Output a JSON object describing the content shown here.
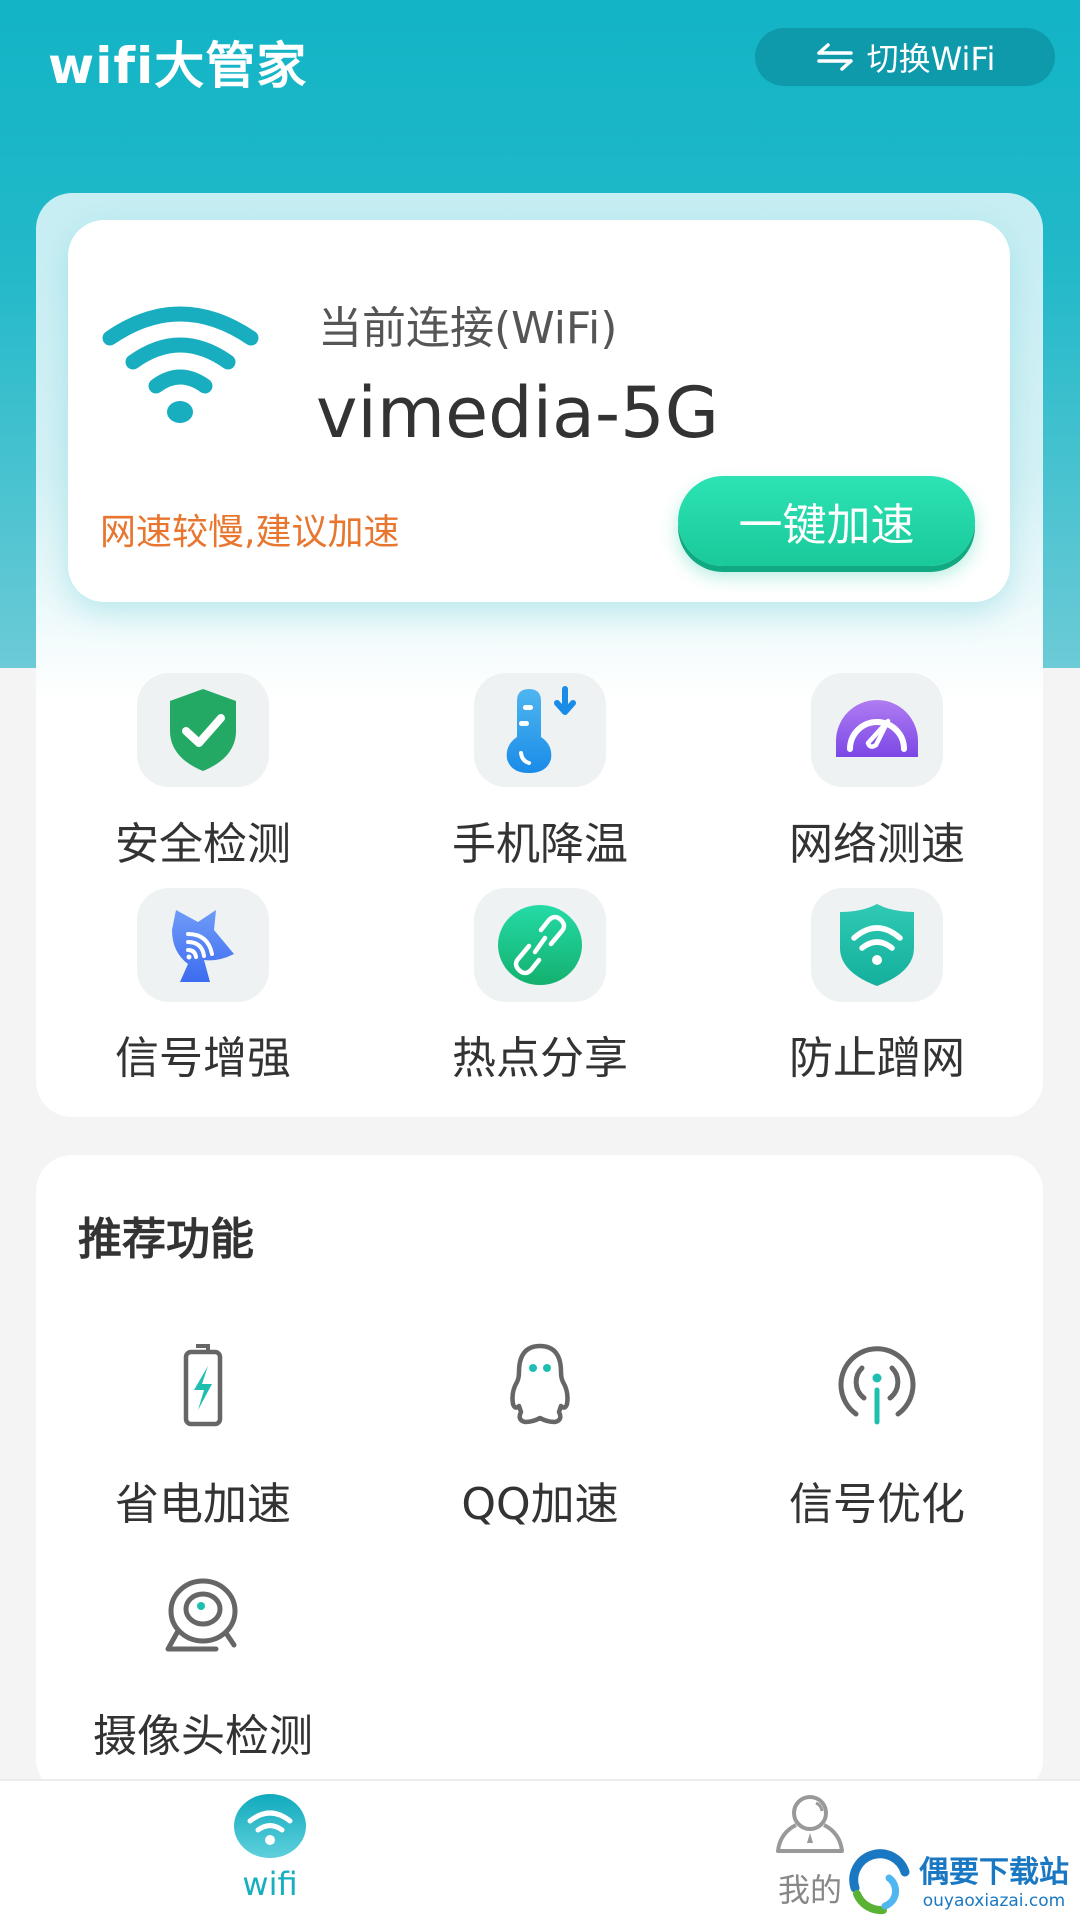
{
  "header": {
    "title": "wifi大管家",
    "switch_button": {
      "label": "切换WiFi",
      "icon": "swap-arrows-icon"
    },
    "colors": {
      "accent": "#12b4c6",
      "switch_bg": "#0e9aab"
    }
  },
  "connection": {
    "label": "当前连接(WiFi)",
    "ssid": "vimedia-5G",
    "tip": "网速较慢,建议加速",
    "boost_button": "一键加速",
    "icon": "wifi-icon",
    "colors": {
      "tip": "#e8762f",
      "boost": "#1fd4a4",
      "wifi": "#18aec0"
    }
  },
  "tools": [
    {
      "label": "安全检测",
      "icon": "shield-check-icon"
    },
    {
      "label": "手机降温",
      "icon": "thermometer-icon"
    },
    {
      "label": "网络测速",
      "icon": "speedometer-icon"
    },
    {
      "label": "信号增强",
      "icon": "satellite-dish-icon"
    },
    {
      "label": "热点分享",
      "icon": "link-icon"
    },
    {
      "label": "防止蹭网",
      "icon": "wifi-shield-icon"
    }
  ],
  "recommended": {
    "title": "推荐功能",
    "items": [
      {
        "label": "省电加速",
        "icon": "battery-icon"
      },
      {
        "label": "QQ加速",
        "icon": "qq-penguin-icon"
      },
      {
        "label": "信号优化",
        "icon": "signal-icon"
      },
      {
        "label": "摄像头检测",
        "icon": "webcam-icon"
      }
    ]
  },
  "bottom_nav": {
    "items": [
      {
        "label": "wifi",
        "icon": "wifi-icon",
        "active": true
      },
      {
        "label": "我的",
        "icon": "user-icon",
        "active": false
      }
    ],
    "colors": {
      "active": "#18aec0",
      "inactive": "#888888"
    }
  },
  "watermark": {
    "name": "偶要下载站",
    "domain": "ouyaoxiazai.com"
  }
}
